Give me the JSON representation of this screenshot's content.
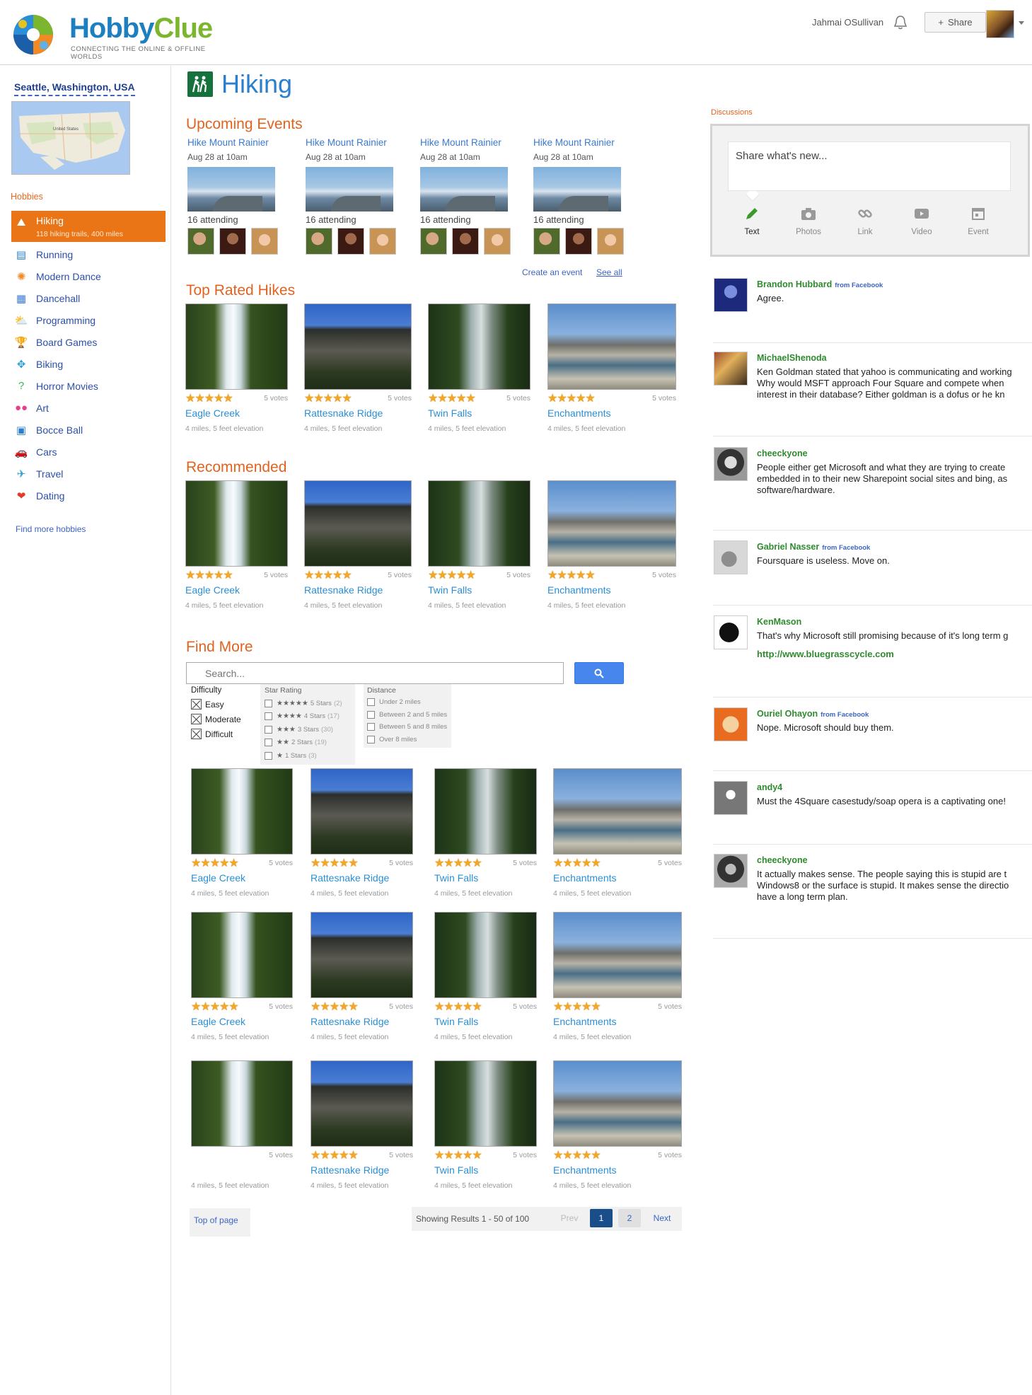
{
  "header": {
    "logo_word1": "Hobby",
    "logo_word2": "Clue",
    "logo_tagline": "CONNECTING THE ONLINE & OFFLINE WORLDS",
    "user_name": "Jahmai OSullivan",
    "share_label": "Share"
  },
  "sidebar": {
    "location": "Seattle, Washington, USA",
    "map_label": "United States",
    "hobbies_heading": "Hobbies",
    "hobbies": [
      {
        "label": "Hiking",
        "sub": "118 hiking trails, 400 miles",
        "icon": "hiking-icon",
        "glyph": "⛰",
        "color": "#ffffff"
      },
      {
        "label": "Running",
        "icon": "running-icon",
        "glyph": "▤",
        "color": "#2a7fcf"
      },
      {
        "label": "Modern Dance",
        "icon": "basketball-icon",
        "glyph": "✺",
        "color": "#f08a24"
      },
      {
        "label": "Dancehall",
        "icon": "dancehall-icon",
        "glyph": "▦",
        "color": "#3a7bd5"
      },
      {
        "label": "Programming",
        "icon": "weather-icon",
        "glyph": "⛅",
        "color": "#2a9fd6"
      },
      {
        "label": "Board Games",
        "icon": "trophy-icon",
        "glyph": "🏆",
        "color": "#e08a00"
      },
      {
        "label": "Biking",
        "icon": "puzzle-icon",
        "glyph": "✥",
        "color": "#2a9fd6"
      },
      {
        "label": "Horror Movies",
        "icon": "question-icon",
        "glyph": "?",
        "color": "#3bb35b"
      },
      {
        "label": "Art",
        "icon": "flickr-icon",
        "glyph": "●●",
        "color": "#e83e8c"
      },
      {
        "label": "Bocce Ball",
        "icon": "briefcase-icon",
        "glyph": "▣",
        "color": "#2a7fcf"
      },
      {
        "label": "Cars",
        "icon": "car-icon",
        "glyph": "🚗",
        "color": "#3a7bd5"
      },
      {
        "label": "Travel",
        "icon": "airplane-icon",
        "glyph": "✈",
        "color": "#2a9fd6"
      },
      {
        "label": "Dating",
        "icon": "hearts-icon",
        "glyph": "❤",
        "color": "#e03a2a"
      }
    ],
    "find_more": "Find more hobbies"
  },
  "main": {
    "title": "Hiking",
    "upcoming_heading": "Upcoming Events",
    "events": [
      {
        "title": "Hike Mount Rainier",
        "date": "Aug 28 at 10am",
        "attending": "16 attending"
      },
      {
        "title": "Hike Mount Rainier",
        "date": "Aug 28 at 10am",
        "attending": "16 attending"
      },
      {
        "title": "Hike Mount Rainier",
        "date": "Aug 28 at 10am",
        "attending": "16 attending"
      },
      {
        "title": "Hike Mount Rainier",
        "date": "Aug 28 at 10am",
        "attending": "16 attending"
      }
    ],
    "create_event": "Create an event",
    "see_all": "See all",
    "top_rated_heading": "Top Rated Hikes",
    "recommended_heading": "Recommended",
    "find_more_heading": "Find More",
    "hikes": [
      {
        "name": "Eagle Creek",
        "votes": "5 votes",
        "meta": "4 miles, 5 feet elevation",
        "rating": 5,
        "image": "waterfall"
      },
      {
        "name": "Rattesnake Ridge",
        "votes": "5 votes",
        "meta": "4 miles, 5 feet elevation",
        "rating": 5,
        "image": "rock"
      },
      {
        "name": "Twin Falls",
        "votes": "5 votes",
        "meta": "4 miles, 5 feet elevation",
        "rating": 5,
        "image": "river"
      },
      {
        "name": "Enchantments",
        "votes": "5 votes",
        "meta": "4 miles, 5 feet elevation",
        "rating": 5,
        "image": "lake"
      }
    ],
    "search_placeholder": "Search...",
    "difficulty": {
      "heading": "Difficulty",
      "options": [
        "Easy",
        "Moderate",
        "Difficult"
      ]
    },
    "star_rating": {
      "heading": "Star Rating",
      "options": [
        {
          "stars": "★★★★★",
          "label": "5 Stars",
          "count": "(2)"
        },
        {
          "stars": "★★★★",
          "label": "4 Stars",
          "count": "(17)"
        },
        {
          "stars": "★★★",
          "label": "3 Stars",
          "count": "(30)"
        },
        {
          "stars": "★★",
          "label": "2 Stars",
          "count": "(19)"
        },
        {
          "stars": "★",
          "label": "1 Stars",
          "count": "(3)"
        }
      ]
    },
    "distance": {
      "heading": "Distance",
      "options": [
        "Under 2 miles",
        "Between 2 and 5 miles",
        "Between 5 and 8 miles",
        "Over 8 miles"
      ]
    },
    "top_of_page": "Top of page",
    "showing": "Showing Results 1 - 50 of 100",
    "prev": "Prev",
    "page1": "1",
    "page2": "2",
    "next": "Next"
  },
  "discussions": {
    "label": "Discussions",
    "share_placeholder": "Share what's new...",
    "tools": [
      "Text",
      "Photos",
      "Link",
      "Video",
      "Event"
    ],
    "posts": [
      {
        "name": "Brandon Hubbard",
        "from": "from Facebook",
        "text": "Agree."
      },
      {
        "name": "MichaelShenoda",
        "from": "",
        "text": "Ken Goldman stated that yahoo is communicating and working\nWhy would MSFT approach Four Square  and compete when\ninterest in their database? Either goldman is a dofus or he kn"
      },
      {
        "name": "cheeckyone",
        "from": "",
        "text": "People either get Microsoft and what they are trying to create\nembedded in to their new Sharepoint social sites and bing, as\nsoftware/hardware."
      },
      {
        "name": "Gabriel Nasser",
        "from": "from Facebook",
        "text": "Foursquare is useless. Move on."
      },
      {
        "name": "KenMason",
        "from": "",
        "text": "That's why Microsoft still promising because of it's long term g",
        "link": "http://www.bluegrasscycle.com"
      },
      {
        "name": "Ouriel Ohayon",
        "from": "from Facebook",
        "text": "Nope. Microsoft should buy them."
      },
      {
        "name": "andy4",
        "from": "",
        "text": "Must the 4Square casestudy/soap opera is a captivating one!"
      },
      {
        "name": "cheeckyone",
        "from": "",
        "text": "It actually makes sense. The people saying this is stupid are t\nWindows8 or the surface is stupid. It makes sense the directio\nhave a long term plan."
      }
    ]
  }
}
